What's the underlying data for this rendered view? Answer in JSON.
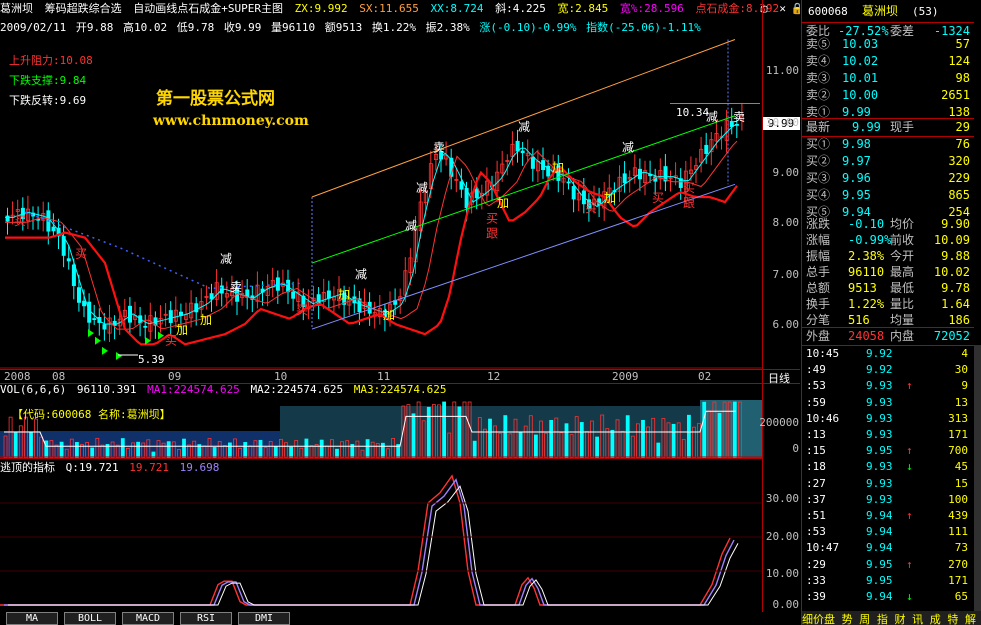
{
  "titlebar": {
    "stock_name": "葛洲坝",
    "formula1": "筹码超跌综合选",
    "formula2": "自动画线点石成金+SUPER主图",
    "zx": "ZX:9.992",
    "sx": "SX:11.655",
    "xx": "XX:8.724",
    "xie": "斜:4.225",
    "kuan": "宽:2.845",
    "kuanpct": "宽%:28.596",
    "brand": "点石成金:8.392"
  },
  "infobar": {
    "date": "2009/02/11",
    "open": "开9.88",
    "high": "高10.02",
    "low": "低9.78",
    "close": "收9.99",
    "volume": "量96110",
    "amount": "额9513",
    "turnover": "换1.22%",
    "amplitude": "振2.38%",
    "change": "涨(-0.10)-0.99%",
    "index": "指数(-25.06)-1.11%"
  },
  "labels": {
    "resistance": "上升阻力:10.08",
    "support": "下跌支撑:9.84",
    "reversal": "下跌反转:9.69",
    "watermark_cn": "第一股票公式网",
    "watermark_url": "www.chnmoney.com",
    "high_mark": "10.34",
    "low_mark": "5.39",
    "sell_tag": "卖",
    "price_tag": "9.99"
  },
  "chart_marks": {
    "jian": "减",
    "jia": "加",
    "mai_buy": "买",
    "mai_sell": "卖",
    "gen": "跟"
  },
  "price_axis": [
    "11.00",
    "10.00",
    "9.00",
    "8.00",
    "7.00",
    "6.00"
  ],
  "date_axis": {
    "labels": [
      "2008",
      "08",
      "09",
      "10",
      "11",
      "12",
      "2009",
      "02"
    ],
    "period": "日线"
  },
  "volume": {
    "label": "VOL(6,6,6)",
    "vol": "96110.391",
    "ma1": "MA1:224574.625",
    "ma2": "MA2:224574.625",
    "ma3": "MA3:224574.625",
    "info_text": "【代码:600068 名称:葛洲坝】",
    "axis": [
      "200000",
      "0"
    ]
  },
  "indicator": {
    "name": "逃顶的指标",
    "q": "Q:19.721",
    "v2": "19.721",
    "v3": "19.698",
    "axis": [
      "30.00",
      "20.00",
      "10.00",
      "0.00"
    ]
  },
  "tabs": [
    "MA",
    "BOLL",
    "MACD",
    "RSI",
    "DMI"
  ],
  "quote": {
    "code": "600068",
    "name": "葛洲坝",
    "count": "(53)",
    "webi_label": "委比",
    "webi": "-27.52%",
    "weicha_label": "委差",
    "weicha": "-1324",
    "sells": [
      {
        "label": "卖⑤",
        "price": "10.03",
        "vol": "57"
      },
      {
        "label": "卖④",
        "price": "10.02",
        "vol": "124"
      },
      {
        "label": "卖③",
        "price": "10.01",
        "vol": "98"
      },
      {
        "label": "卖②",
        "price": "10.00",
        "vol": "2651"
      },
      {
        "label": "卖①",
        "price": "9.99",
        "vol": "138"
      }
    ],
    "latest_label": "最新",
    "latest": "9.99",
    "xianshou_label": "现手",
    "xianshou": "29",
    "buys": [
      {
        "label": "买①",
        "price": "9.98",
        "vol": "76"
      },
      {
        "label": "买②",
        "price": "9.97",
        "vol": "320"
      },
      {
        "label": "买③",
        "price": "9.96",
        "vol": "229"
      },
      {
        "label": "买④",
        "price": "9.95",
        "vol": "865"
      },
      {
        "label": "买⑤",
        "price": "9.94",
        "vol": "254"
      }
    ],
    "stats": [
      {
        "l1": "涨跌",
        "v1": "-0.10",
        "l2": "均价",
        "v2": "9.90"
      },
      {
        "l1": "涨幅",
        "v1": "-0.99%",
        "l2": "前收",
        "v2": "10.09"
      },
      {
        "l1": "振幅",
        "v1": "2.38%",
        "l2": "今开",
        "v2": "9.88"
      },
      {
        "l1": "总手",
        "v1": "96110",
        "l2": "最高",
        "v2": "10.02"
      },
      {
        "l1": "总额",
        "v1": "9513",
        "l2": "最低",
        "v2": "9.78"
      },
      {
        "l1": "换手",
        "v1": "1.22%",
        "l2": "量比",
        "v2": "1.64"
      },
      {
        "l1": "分笔",
        "v1": "516",
        "l2": "均量",
        "v2": "186"
      }
    ],
    "waipan_label": "外盘",
    "waipan": "24058",
    "neipan_label": "内盘",
    "neipan": "72052"
  },
  "ticks": [
    {
      "t": "10:45",
      "p": "9.92",
      "d": "",
      "v": "4"
    },
    {
      "t": ":49",
      "p": "9.92",
      "d": "",
      "v": "30"
    },
    {
      "t": ":53",
      "p": "9.93",
      "d": "↑",
      "v": "9"
    },
    {
      "t": ":59",
      "p": "9.93",
      "d": "",
      "v": "13"
    },
    {
      "t": "10:46",
      "p": "9.93",
      "d": "",
      "v": "313"
    },
    {
      "t": ":13",
      "p": "9.93",
      "d": "",
      "v": "171"
    },
    {
      "t": ":15",
      "p": "9.95",
      "d": "↑",
      "v": "700"
    },
    {
      "t": ":18",
      "p": "9.93",
      "d": "↓",
      "v": "45"
    },
    {
      "t": ":27",
      "p": "9.93",
      "d": "",
      "v": "15"
    },
    {
      "t": ":37",
      "p": "9.93",
      "d": "",
      "v": "100"
    },
    {
      "t": ":51",
      "p": "9.94",
      "d": "↑",
      "v": "439"
    },
    {
      "t": ":53",
      "p": "9.94",
      "d": "",
      "v": "111"
    },
    {
      "t": "10:47",
      "p": "9.94",
      "d": "",
      "v": "73"
    },
    {
      "t": ":29",
      "p": "9.95",
      "d": "↑",
      "v": "270"
    },
    {
      "t": ":33",
      "p": "9.95",
      "d": "",
      "v": "171"
    },
    {
      "t": ":39",
      "p": "9.94",
      "d": "↓",
      "v": "65"
    }
  ],
  "footer": "细价盘 势 周 指 财 讯 成 特 解",
  "colors": {
    "up": "#ff3232",
    "down": "#00ffff",
    "yellow": "#ffff00",
    "magenta": "#ff00ff",
    "green": "#00ff00",
    "grid": "#b00000"
  }
}
